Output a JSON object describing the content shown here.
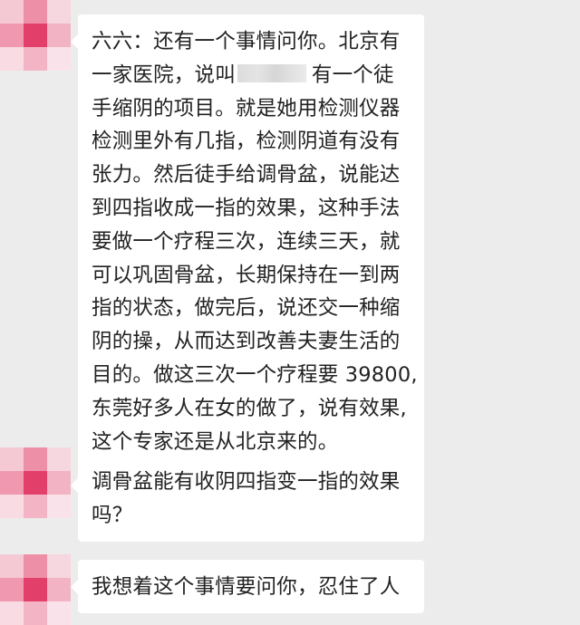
{
  "messages": [
    {
      "sender": "received",
      "lines": [
        "六六：还有一个事情问你。北京有",
        {
          "before": "一家医院，说叫",
          "after": "有一个徒"
        },
        "手缩阴的项目。就是她用检测仪器",
        "检测里外有几指，检测阴道有没有",
        "张力。然后徒手给调骨盆，说能达",
        "到四指收成一指的效果，这种手法",
        "要做一个疗程三次，连续三天，就",
        "可以巩固骨盆，长期保持在一到两",
        "指的状态，做完后，说还交一种缩",
        "阴的操，从而达到改善夫妻生活的",
        "目的。做这三次一个疗程要 39800,",
        "东莞好多人在女的做了，说有效果,",
        "这个专家还是从北京来的。"
      ]
    },
    {
      "sender": "received",
      "lines": [
        "调骨盆能有收阴四指变一指的效果",
        "吗？"
      ]
    },
    {
      "sender": "received",
      "lines": [
        "我想着这个事情要问你，忍住了人"
      ]
    }
  ]
}
